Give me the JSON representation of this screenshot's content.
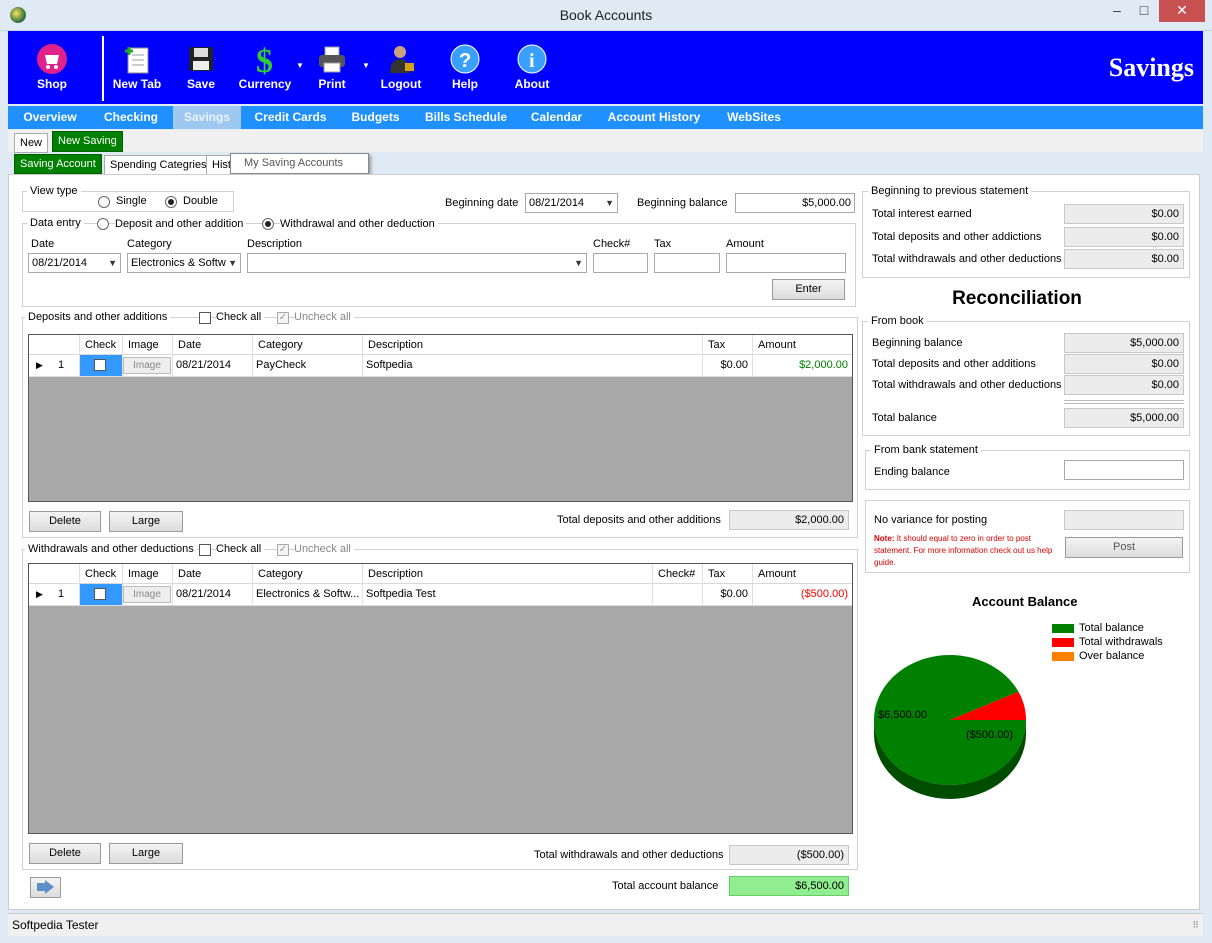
{
  "window": {
    "title": "Book Accounts",
    "minimize": "–",
    "maximize": "□",
    "close": "✕"
  },
  "toolbar": {
    "items": [
      {
        "label": "Shop",
        "icon": "shop-icon"
      },
      {
        "label": "New Tab",
        "icon": "new-tab-icon"
      },
      {
        "label": "Save",
        "icon": "floppy-disk-icon"
      },
      {
        "label": "Currency",
        "icon": "dollar-icon"
      },
      {
        "label": "Print",
        "icon": "printer-icon"
      },
      {
        "label": "Logout",
        "icon": "logout-person-icon"
      },
      {
        "label": "Help",
        "icon": "help-icon"
      },
      {
        "label": "About",
        "icon": "info-icon"
      }
    ],
    "section_title": "Savings"
  },
  "nav": {
    "items": [
      "Overview",
      "Checking",
      "Savings",
      "Credit Cards",
      "Budgets",
      "Bills Schedule",
      "Calendar",
      "Account History",
      "WebSites"
    ],
    "selected": "Savings"
  },
  "subtabs": {
    "new": "New",
    "new_saving": "New Saving"
  },
  "innertabs": {
    "saving_account": "Saving Account",
    "spending": "Spending Categries",
    "hist": "Hist",
    "tooltip": "My Saving Accounts"
  },
  "viewtype": {
    "label": "View type",
    "single": "Single",
    "double": "Double",
    "selected": "Double"
  },
  "beginning": {
    "date_label": "Beginning date",
    "date": "08/21/2014",
    "balance_label": "Beginning balance",
    "balance": "$5,000.00"
  },
  "dataentry": {
    "label": "Data entry",
    "deposit": "Deposit and other addition",
    "withdrawal": "Withdrawal and other deduction",
    "selected": "Withdrawal and other deduction",
    "date_label": "Date",
    "date": "08/21/2014",
    "category_label": "Category",
    "category": "Electronics & Softw",
    "description_label": "Description",
    "description": "",
    "check_label": "Check#",
    "tax_label": "Tax",
    "amount_label": "Amount",
    "enter": "Enter"
  },
  "deposits": {
    "title": "Deposits and other additions",
    "check_all": "Check all",
    "uncheck_all": "Uncheck all",
    "columns": [
      "Check",
      "Image",
      "Date",
      "Category",
      "Description",
      "Tax",
      "Amount"
    ],
    "rows": [
      {
        "num": "1",
        "image": "Image",
        "date": "08/21/2014",
        "category": "PayCheck",
        "description": "Softpedia",
        "tax": "$0.00",
        "amount": "$2,000.00"
      }
    ],
    "delete": "Delete",
    "large": "Large",
    "total_label": "Total deposits  and other additions",
    "total": "$2,000.00"
  },
  "withdrawals": {
    "title": "Withdrawals  and other deductions",
    "check_all": "Check all",
    "uncheck_all": "Uncheck all",
    "columns": [
      "Check",
      "Image",
      "Date",
      "Category",
      "Description",
      "Check#",
      "Tax",
      "Amount"
    ],
    "rows": [
      {
        "num": "1",
        "image": "Image",
        "date": "08/21/2014",
        "category": "Electronics & Softw...",
        "description": "Softpedia Test",
        "check": "",
        "tax": "$0.00",
        "amount": "($500.00)"
      }
    ],
    "delete": "Delete",
    "large": "Large",
    "total_label": "Total withdrawals and other deductions",
    "total": "($500.00)"
  },
  "account_total": {
    "label": "Total account balance",
    "value": "$6,500.00"
  },
  "prev_statement": {
    "title": "Beginning to previous statement",
    "interest_label": "Total interest earned",
    "interest": "$0.00",
    "deposits_label": "Total deposits and other addictions",
    "deposits": "$0.00",
    "withdrawals_label": "Total withdrawals and other deductions",
    "withdrawals": "$0.00"
  },
  "reconciliation": {
    "title": "Reconciliation",
    "from_book": "From book",
    "beg_label": "Beginning balance",
    "beg": "$5,000.00",
    "dep_label": "Total deposits and other additions",
    "dep": "$0.00",
    "wd_label": "Total withdrawals and other deductions",
    "wd": "$0.00",
    "total_label": "Total balance",
    "total": "$5,000.00",
    "bank_title": "From bank statement",
    "ending_label": "Ending balance",
    "ending": "",
    "variance_label": "No variance for posting",
    "variance": "",
    "note_label": "Note:",
    "note": "It should equal to zero in order to post statement. For more information check out us help guide.",
    "post": "Post"
  },
  "chart": {
    "title": "Account Balance",
    "legend": [
      {
        "name": "Total balance",
        "color": "#008000"
      },
      {
        "name": "Total withdrawals",
        "color": "#ff0000"
      },
      {
        "name": "Over balance",
        "color": "#ff8000"
      }
    ],
    "label_balance": "$6,500.00",
    "label_withdrawals": "($500.00)"
  },
  "chart_data": {
    "type": "pie",
    "title": "Account Balance",
    "categories": [
      "Total balance",
      "Total withdrawals",
      "Over balance"
    ],
    "values": [
      6500,
      500,
      0
    ]
  },
  "statusbar": {
    "user": "Softpedia Tester"
  }
}
